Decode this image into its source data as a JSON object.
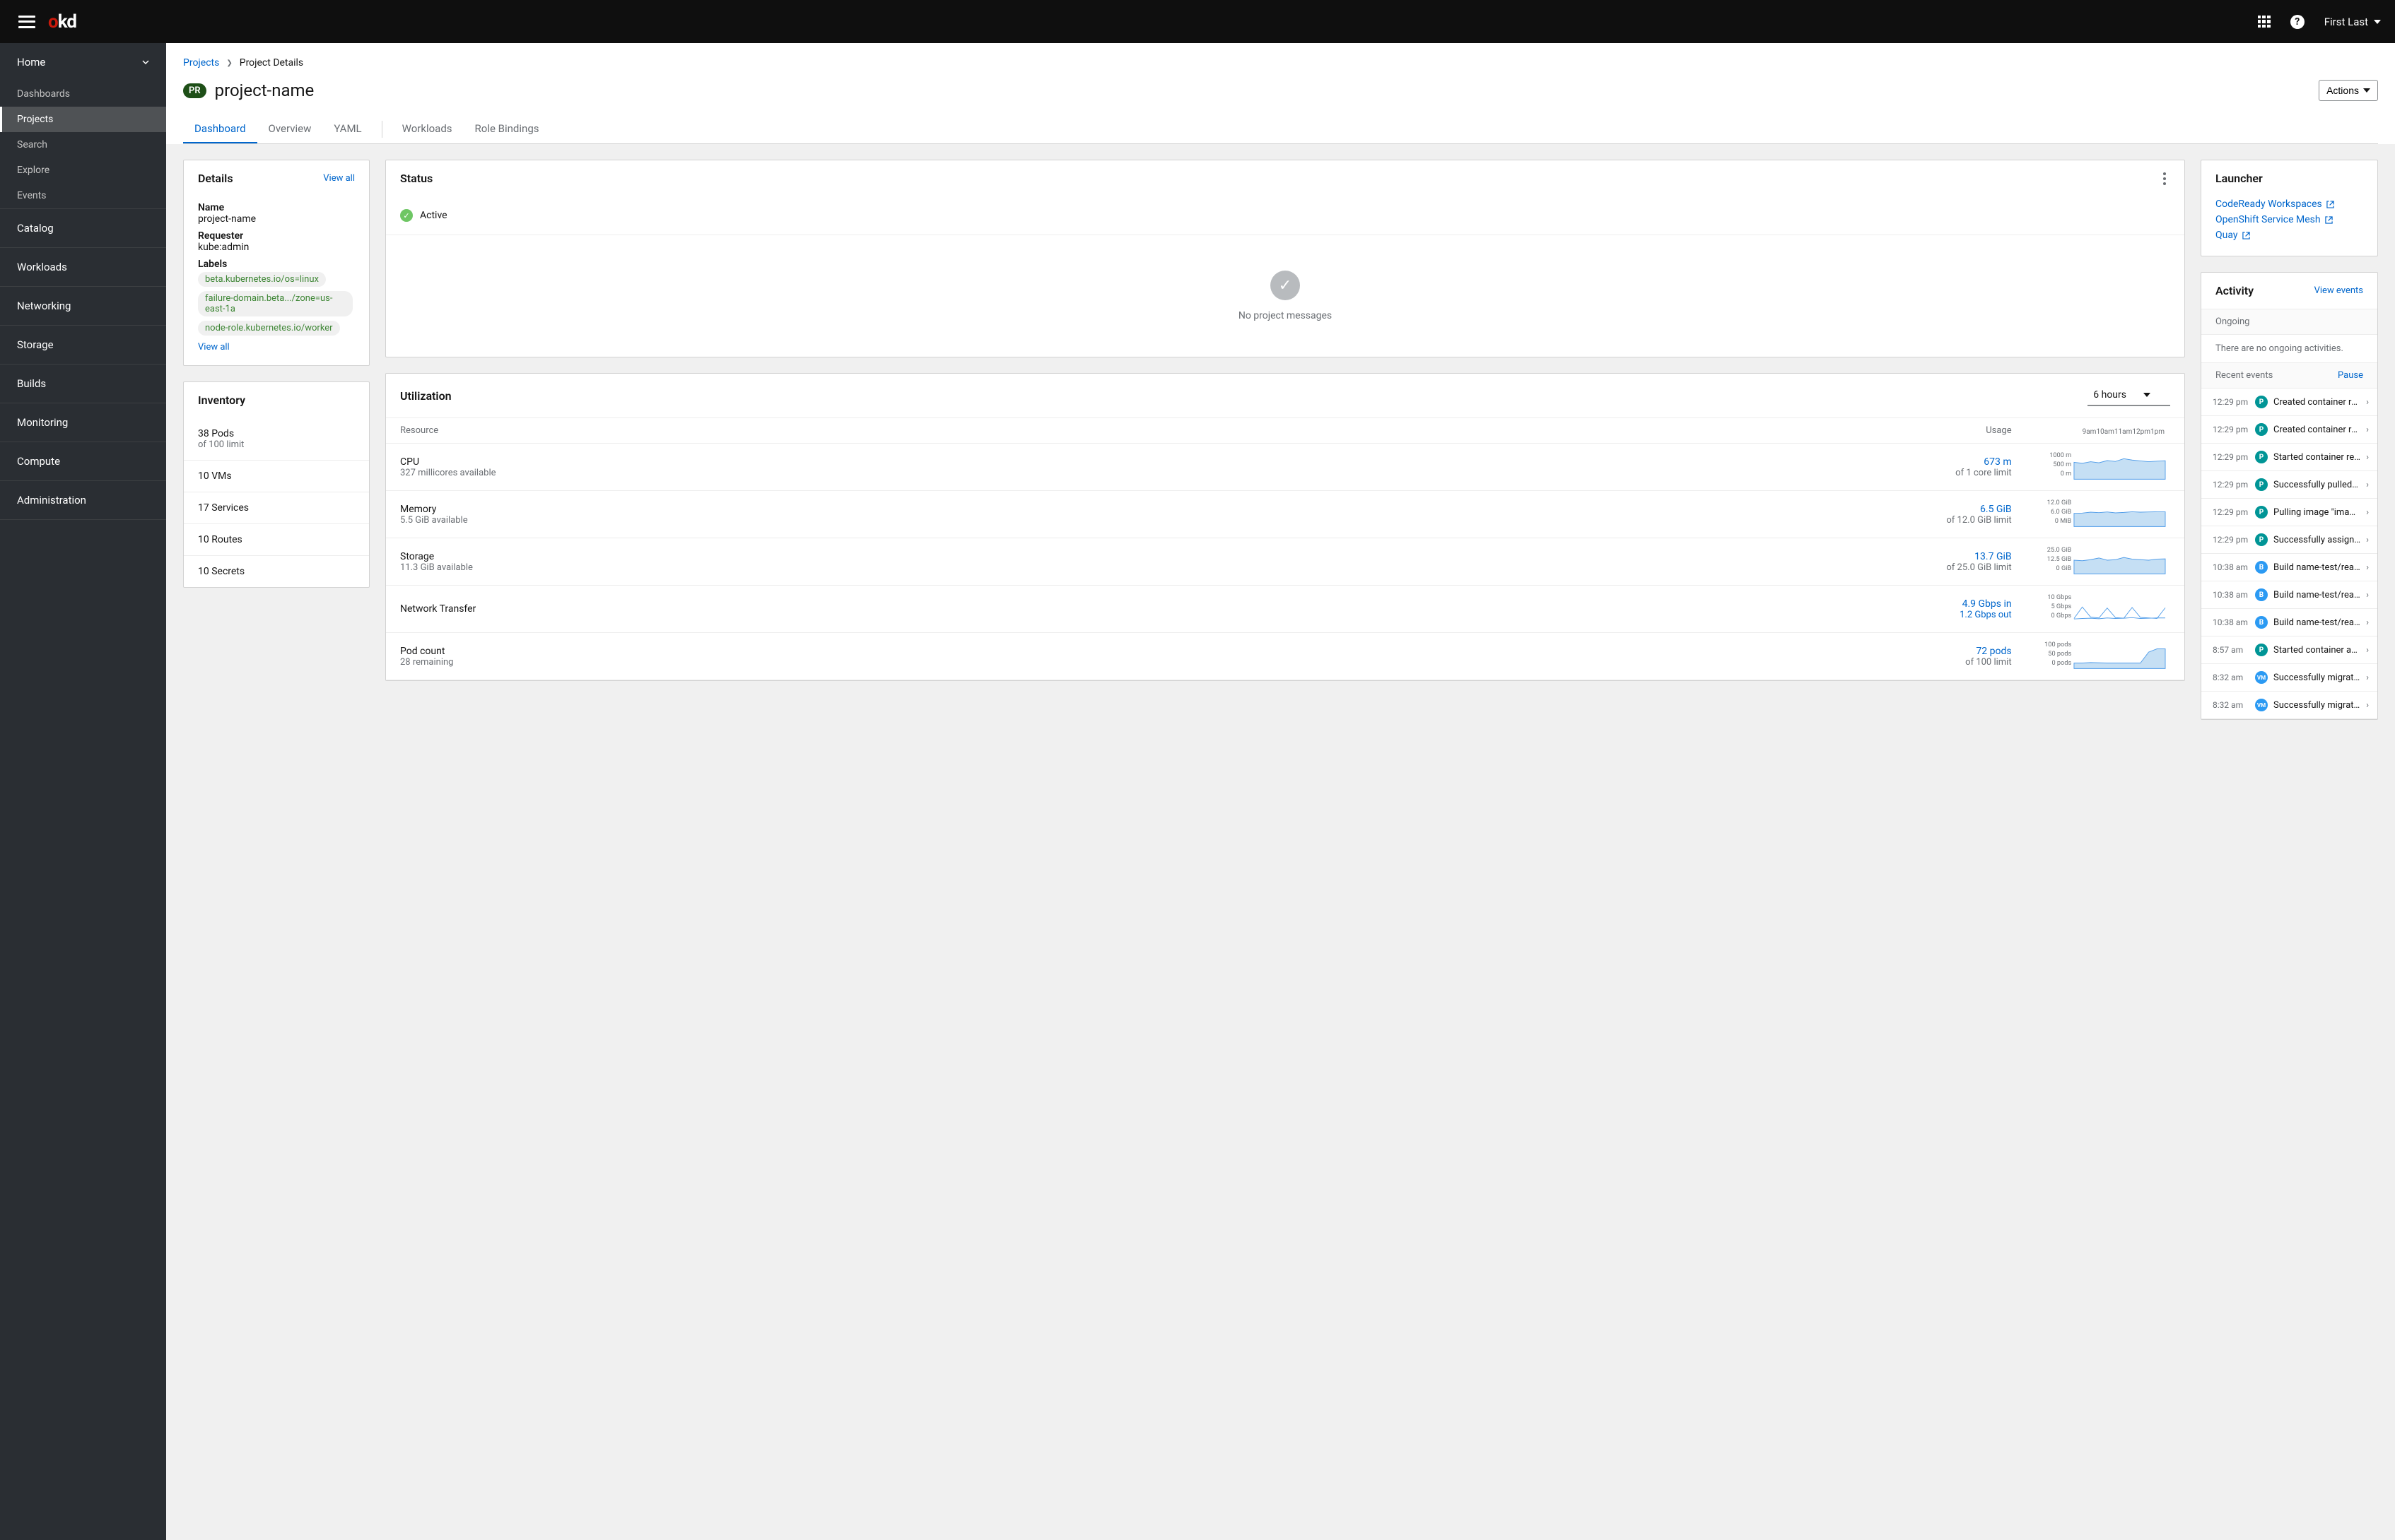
{
  "topbar": {
    "logo_o": "o",
    "logo_kd": "kd",
    "user": "First Last"
  },
  "sidebar": {
    "home": {
      "label": "Home",
      "items": [
        "Dashboards",
        "Projects",
        "Search",
        "Explore",
        "Events"
      ],
      "active_index": 1
    },
    "sections": [
      "Catalog",
      "Workloads",
      "Networking",
      "Storage",
      "Builds",
      "Monitoring",
      "Compute",
      "Administration"
    ]
  },
  "breadcrumb": {
    "parent": "Projects",
    "current": "Project Details"
  },
  "title": {
    "badge": "PR",
    "name": "project-name",
    "actions": "Actions"
  },
  "tabs": [
    "Dashboard",
    "Overview",
    "YAML",
    "Workloads",
    "Role Bindings"
  ],
  "details": {
    "title": "Details",
    "view_all": "View all",
    "name_label": "Name",
    "name_value": "project-name",
    "requester_label": "Requester",
    "requester_value": "kube:admin",
    "labels_label": "Labels",
    "labels": [
      "beta.kubernetes.io/os=linux",
      "failure-domain.beta.../zone=us-east-1a",
      "node-role.kubernetes.io/worker"
    ],
    "view_all2": "View all"
  },
  "inventory": {
    "title": "Inventory",
    "items": [
      {
        "text": "38 Pods",
        "sub": "of 100 limit"
      },
      {
        "text": "10 VMs",
        "sub": ""
      },
      {
        "text": "17 Services",
        "sub": ""
      },
      {
        "text": "10 Routes",
        "sub": ""
      },
      {
        "text": "10 Secrets",
        "sub": ""
      }
    ]
  },
  "status": {
    "title": "Status",
    "state": "Active",
    "empty": "No project messages"
  },
  "utilization": {
    "title": "Utilization",
    "range": "6 hours",
    "headers": {
      "resource": "Resource",
      "usage": "Usage"
    },
    "time_labels": [
      "9am",
      "10am",
      "11am",
      "12pm",
      "1pm"
    ],
    "rows": [
      {
        "name": "CPU",
        "sub": "327 millicores available",
        "usage": "673 m",
        "usage_sub": "of 1 core limit",
        "ticks": [
          "1000 m",
          "500 m",
          "0 m"
        ]
      },
      {
        "name": "Memory",
        "sub": "5.5 GiB available",
        "usage": "6.5 GiB",
        "usage_sub": "of 12.0 GiB limit",
        "ticks": [
          "12.0 GiB",
          "6.0 GiB",
          "0 MiB"
        ]
      },
      {
        "name": "Storage",
        "sub": "11.3 GiB available",
        "usage": "13.7 GiB",
        "usage_sub": "of 25.0 GiB limit",
        "ticks": [
          "25.0 GiB",
          "12.5 GiB",
          "0 GiB"
        ]
      },
      {
        "name": "Network Transfer",
        "sub": "",
        "usage": "4.9 Gbps in",
        "usage_sub": "1.2 Gbps out",
        "usage_sub_link": true,
        "ticks": [
          "10 Gbps",
          "5 Gbps",
          "0 Gbps"
        ]
      },
      {
        "name": "Pod count",
        "sub": "28 remaining",
        "usage": "72 pods",
        "usage_sub": "of 100 limit",
        "ticks": [
          "100 pods",
          "50 pods",
          "0 pods"
        ]
      }
    ]
  },
  "launcher": {
    "title": "Launcher",
    "items": [
      "CodeReady Workspaces",
      "OpenShift Service Mesh",
      "Quay"
    ]
  },
  "activity": {
    "title": "Activity",
    "view_events": "View events",
    "ongoing_label": "Ongoing",
    "ongoing_empty": "There are no ongoing activities.",
    "recent_label": "Recent events",
    "pause": "Pause",
    "events": [
      {
        "time": "12:29 pm",
        "badge": "P",
        "text": "Created container reacta..."
      },
      {
        "time": "12:29 pm",
        "badge": "P",
        "text": "Created container reacta..."
      },
      {
        "time": "12:29 pm",
        "badge": "P",
        "text": "Started container reacta..."
      },
      {
        "time": "12:29 pm",
        "badge": "P",
        "text": "Successfully pulled imag..."
      },
      {
        "time": "12:29 pm",
        "badge": "P",
        "text": "Pulling image \"image-re..."
      },
      {
        "time": "12:29 pm",
        "badge": "P",
        "text": "Successfully assigned ap..."
      },
      {
        "time": "10:38 am",
        "badge": "B",
        "text": "Build name-test/react-we..."
      },
      {
        "time": "10:38 am",
        "badge": "B",
        "text": "Build name-test/react-we..."
      },
      {
        "time": "10:38 am",
        "badge": "B",
        "text": "Build name-test/react-we..."
      },
      {
        "time": "8:57 am",
        "badge": "P",
        "text": "Started container appde..."
      },
      {
        "time": "8:32 am",
        "badge": "VM",
        "text": "Successfully migrated V..."
      },
      {
        "time": "8:32 am",
        "badge": "VM",
        "text": "Successfully migrated V..."
      }
    ]
  },
  "chart_data": [
    {
      "type": "area",
      "name": "CPU",
      "x_labels": [
        "9am",
        "10am",
        "11am",
        "12pm",
        "1pm"
      ],
      "values": [
        620,
        580,
        640,
        600,
        680,
        650,
        750,
        700,
        670,
        640,
        660,
        673
      ],
      "ylim": [
        0,
        1000
      ],
      "unit": "m"
    },
    {
      "type": "area",
      "name": "Memory",
      "x_labels": [
        "9am",
        "10am",
        "11am",
        "12pm",
        "1pm"
      ],
      "values": [
        5.8,
        5.9,
        6.3,
        6.1,
        6.4,
        6.0,
        6.2,
        6.5,
        6.3,
        6.4,
        6.5,
        6.5
      ],
      "ylim": [
        0,
        12
      ],
      "unit": "GiB"
    },
    {
      "type": "area",
      "name": "Storage",
      "x_labels": [
        "9am",
        "10am",
        "11am",
        "12pm",
        "1pm"
      ],
      "values": [
        12.5,
        12.0,
        13.0,
        14.5,
        12.5,
        13.0,
        15.0,
        13.5,
        13.0,
        12.5,
        13.5,
        13.7
      ],
      "ylim": [
        0,
        25
      ],
      "unit": "GiB"
    },
    {
      "type": "line",
      "name": "Network Transfer",
      "x_labels": [
        "9am",
        "10am",
        "11am",
        "12pm",
        "1pm"
      ],
      "series": [
        {
          "name": "in",
          "values": [
            1.0,
            5.2,
            1.5,
            1.2,
            4.8,
            1.3,
            1.1,
            5.0,
            1.4,
            1.2,
            1.0,
            4.9
          ]
        },
        {
          "name": "out",
          "values": [
            0.8,
            1.0,
            1.1,
            0.9,
            1.2,
            1.0,
            1.1,
            1.3,
            1.0,
            1.1,
            1.2,
            1.2
          ]
        }
      ],
      "ylim": [
        0,
        10
      ],
      "unit": "Gbps"
    },
    {
      "type": "area",
      "name": "Pod count",
      "x_labels": [
        "9am",
        "10am",
        "11am",
        "12pm",
        "1pm"
      ],
      "values": [
        20,
        20,
        22,
        21,
        20,
        20,
        20,
        20,
        20,
        60,
        72,
        72
      ],
      "ylim": [
        0,
        100
      ],
      "unit": "pods"
    }
  ]
}
